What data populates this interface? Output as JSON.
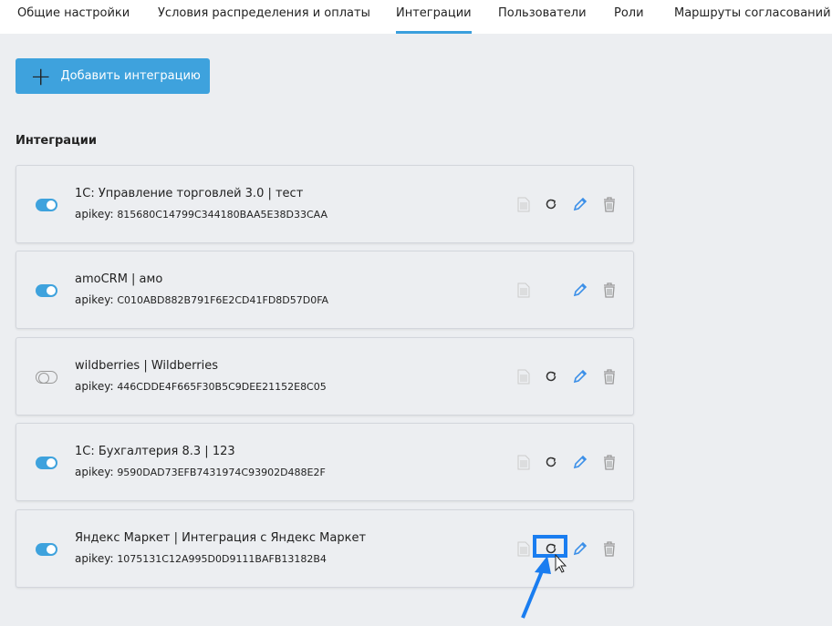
{
  "tabs": [
    "Общие настройки",
    "Условия распределения и оплаты",
    "Интеграции",
    "Пользователи",
    "Роли",
    "Маршруты согласований"
  ],
  "active_tab": 2,
  "add_button": "Добавить интеграцию",
  "section_title": "Интеграции",
  "apikey_label": "apikey:",
  "colors": {
    "accent": "#3ea2dd",
    "highlight": "#1a7df0",
    "pencil": "#3b8fe8"
  },
  "integrations": [
    {
      "name": "1С: Управление торговлей 3.0 | тест",
      "apikey": "815680C14799C344180BAA5E38D33CAA",
      "enabled": true,
      "has_refresh": true
    },
    {
      "name": "amoCRM | амо",
      "apikey": "C010ABD882B791F6E2CD41FD8D57D0FA",
      "enabled": true,
      "has_refresh": false
    },
    {
      "name": "wildberries | Wildberries",
      "apikey": "446CDDE4F665F30B5C9DEE21152E8C05",
      "enabled": false,
      "has_refresh": true
    },
    {
      "name": "1С: Бухгалтерия 8.3 | 123",
      "apikey": "9590DAD73EFB7431974C93902D488E2F",
      "enabled": true,
      "has_refresh": true
    },
    {
      "name": "Яндекс Маркет | Интеграция с Яндекс Маркет",
      "apikey": "1075131C12A995D0D9111BAFB13182B4",
      "enabled": true,
      "has_refresh": true
    }
  ]
}
